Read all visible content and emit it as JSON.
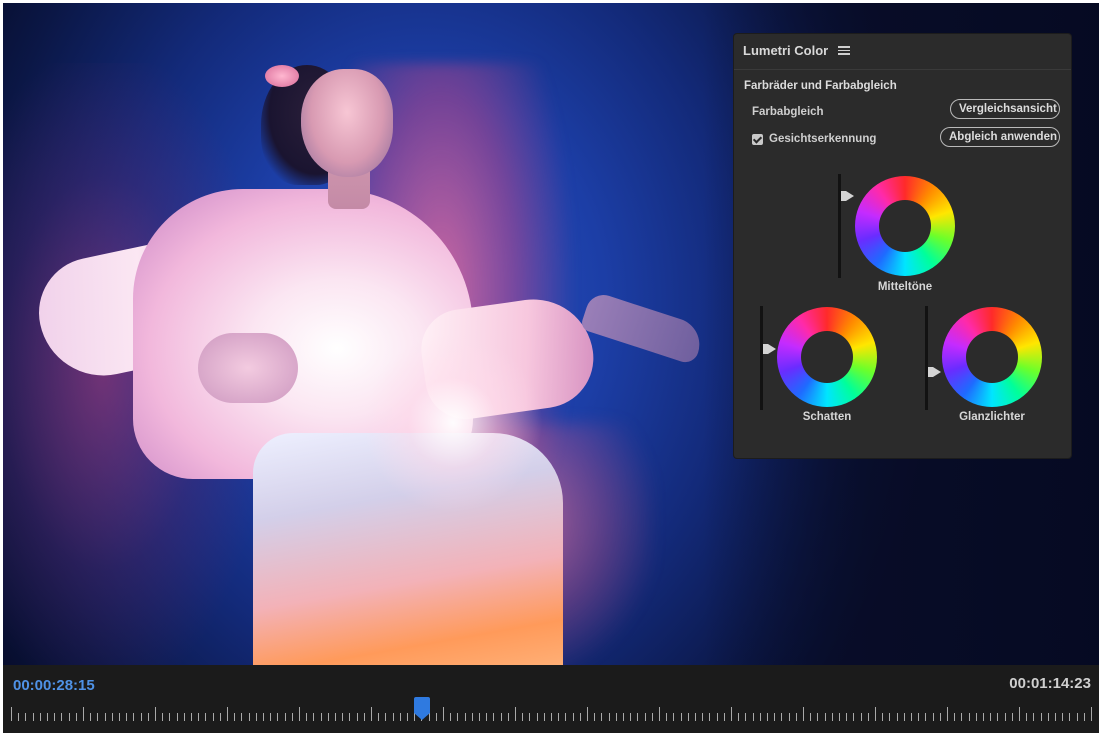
{
  "panel": {
    "title": "Lumetri Color",
    "section_title": "Farbräder und Farbabgleich",
    "color_match_label": "Farbabgleich",
    "compare_button": "Vergleichsansicht",
    "apply_button": "Abgleich anwenden",
    "face_detection_label": "Gesichtserkennung",
    "face_detection_checked": true,
    "wheels": {
      "midtones_label": "Mitteltöne",
      "shadows_label": "Schatten",
      "highlights_label": "Glanzlichter"
    }
  },
  "timeline": {
    "current_timecode": "00:00:28:15",
    "total_timecode": "00:01:14:23",
    "playhead_progress": 0.38
  },
  "colors": {
    "accent": "#2f7ae0",
    "timecode_current": "#4f92e6",
    "panel_bg": "#2b2b2b"
  },
  "icons": {
    "panel_menu": "hamburger-menu-icon",
    "checkbox": "checkmark-icon"
  }
}
